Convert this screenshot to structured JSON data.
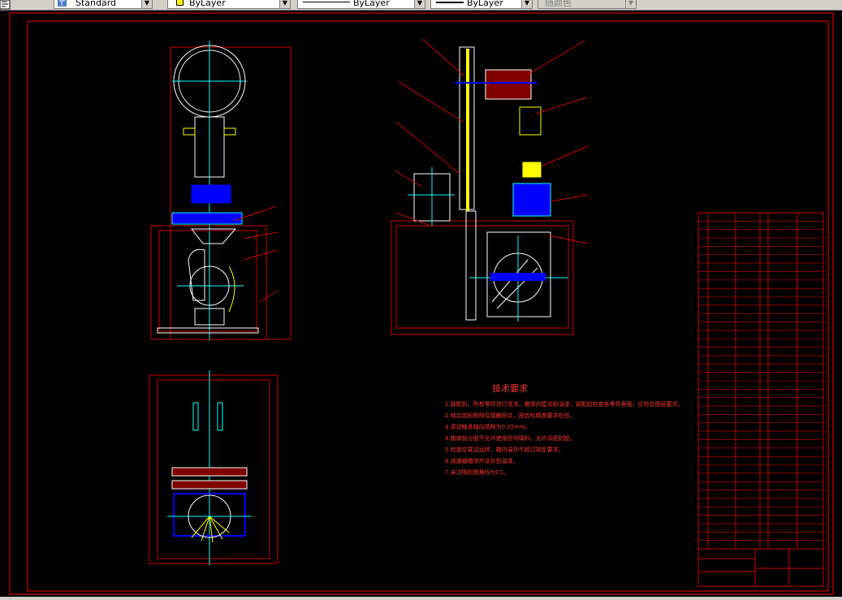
{
  "toolbar": {
    "text_style": "Standard",
    "layer": "ByLayer",
    "linetype": "ByLayer",
    "lineweight": "ByLayer",
    "color": "随颜色"
  },
  "colors": {
    "background": "#000000",
    "border": "#ff0000",
    "frame": "#cc0000",
    "centerline": "#00ffff",
    "part_blue": "#0000ff",
    "part_yellow": "#ffff00",
    "part_white": "#ffffff",
    "part_dark_red": "#800000",
    "notes_text": "#ff3333"
  },
  "drawing": {
    "tech_title": "技术要求",
    "tech_notes": [
      "1.装配前，所有零件进行清洗，箱体内壁涂耐油漆，装配前检查各零件表面，应符合图纸要求。",
      "2.啮合齿轮侧隙及接触斑点，按齿轮精度要求检验。",
      "3.滚动轴承轴向游隙为0.25mm。",
      "4.箱体剖分面不允许使用任何填料，允许涂密封胶。",
      "5.检查空载试运转，箱内温升不超过规定要求。",
      "6.减速器箱体外涂灰色油漆。",
      "7.未注明的倒角均为C1。"
    ],
    "bom_row_count": 40
  }
}
